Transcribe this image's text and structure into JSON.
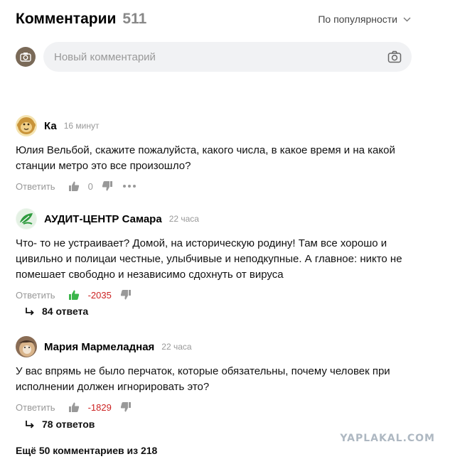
{
  "header": {
    "title": "Комментарии",
    "count": "511",
    "sort_label": "По популярности"
  },
  "new_comment": {
    "placeholder": "Новый комментарий"
  },
  "comments": [
    {
      "author": "Ка",
      "time": "16 минут",
      "text": "Юлия Вельбой, скажите пожалуйста, какого числа, в какое время и на какой станции метро это все произошло?",
      "reply_label": "Ответить",
      "score": "0",
      "score_color": "#999999",
      "like_active": false
    },
    {
      "author": "АУДИТ-ЦЕНТР Самара",
      "time": "22 часа",
      "text": "Что- то не устраивает? Домой, на историческую родину! Там все хорошо и цивильно и полицаи честные, улыбчивые и неподкупные. А главное: никто не помешает свободно и независимо сдохнуть от вируса",
      "reply_label": "Ответить",
      "score": "-2035",
      "score_color": "#cc2222",
      "like_active": true,
      "answers": "84 ответа"
    },
    {
      "author": "Мария Мармеладная",
      "time": "22 часа",
      "text": "У вас впрямь не было перчаток, которые обязательны, почему человек при исполнении должен игнорировать это?",
      "reply_label": "Ответить",
      "score": "-1829",
      "score_color": "#cc2222",
      "like_active": false,
      "answers": "78 ответов"
    }
  ],
  "footer": {
    "more_label": "Ещё 50 комментариев из 218"
  },
  "watermark": "YAPLAKAL.COM",
  "colors": {
    "like_active": "#3bb54a",
    "negative": "#cc2222",
    "muted": "#999999",
    "input_bg": "#f1f2f4"
  }
}
